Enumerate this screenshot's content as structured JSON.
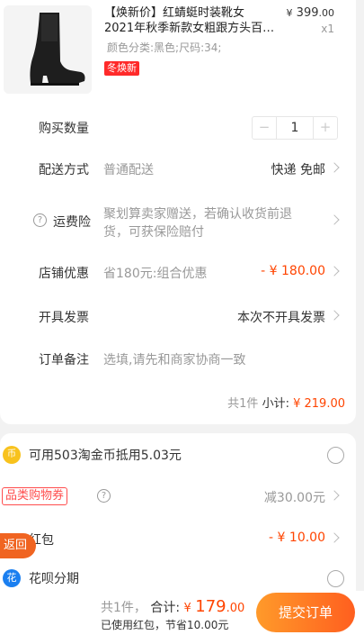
{
  "product": {
    "title_line1": "【焕新价】红蜻蜓时装靴女",
    "title_line2": "2021年秋季新款女粗跟方头百…",
    "price_symbol": "¥",
    "price_int": "399",
    "price_dec": ".00",
    "quantity_label": "x1",
    "sku": "颜色分类:黑色;尺码:34;",
    "badge": "冬焕新"
  },
  "order": {
    "qty_label": "购买数量",
    "qty_value": "1",
    "qty_minus": "−",
    "qty_plus": "+",
    "delivery_label": "配送方式",
    "delivery_sub": "普通配送",
    "delivery_value": "快递 免邮",
    "insurance_label": "运费险",
    "insurance_text": "聚划算卖家赠送，若确认收货前退货，可获保险赔付",
    "discount_label": "店铺优惠",
    "discount_sub": "省180元:组合优惠",
    "discount_value": "- ¥ 180.00",
    "invoice_label": "开具发票",
    "invoice_value": "本次不开具发票",
    "note_label": "订单备注",
    "note_placeholder": "选填,请先和商家协商一致",
    "subtotal_count": "共1件",
    "subtotal_key": "小计:",
    "subtotal_value": "¥ 219.00"
  },
  "payment": {
    "coin_text": "可用503淘金币抵用5.03元",
    "coupon_tag": "品类购物券",
    "coupon_value": "减30.00元",
    "redpacket_label": "红包",
    "redpacket_value": "- ¥ 10.00",
    "huabei_label": "花呗分期",
    "back_label": "返回"
  },
  "footer": {
    "count": "共1件，",
    "total_key": "合计:",
    "total_symbol": "¥",
    "total_int": "179",
    "total_dec": ".00",
    "note": "已使用红包，节省10.00元",
    "submit": "提交订单"
  }
}
